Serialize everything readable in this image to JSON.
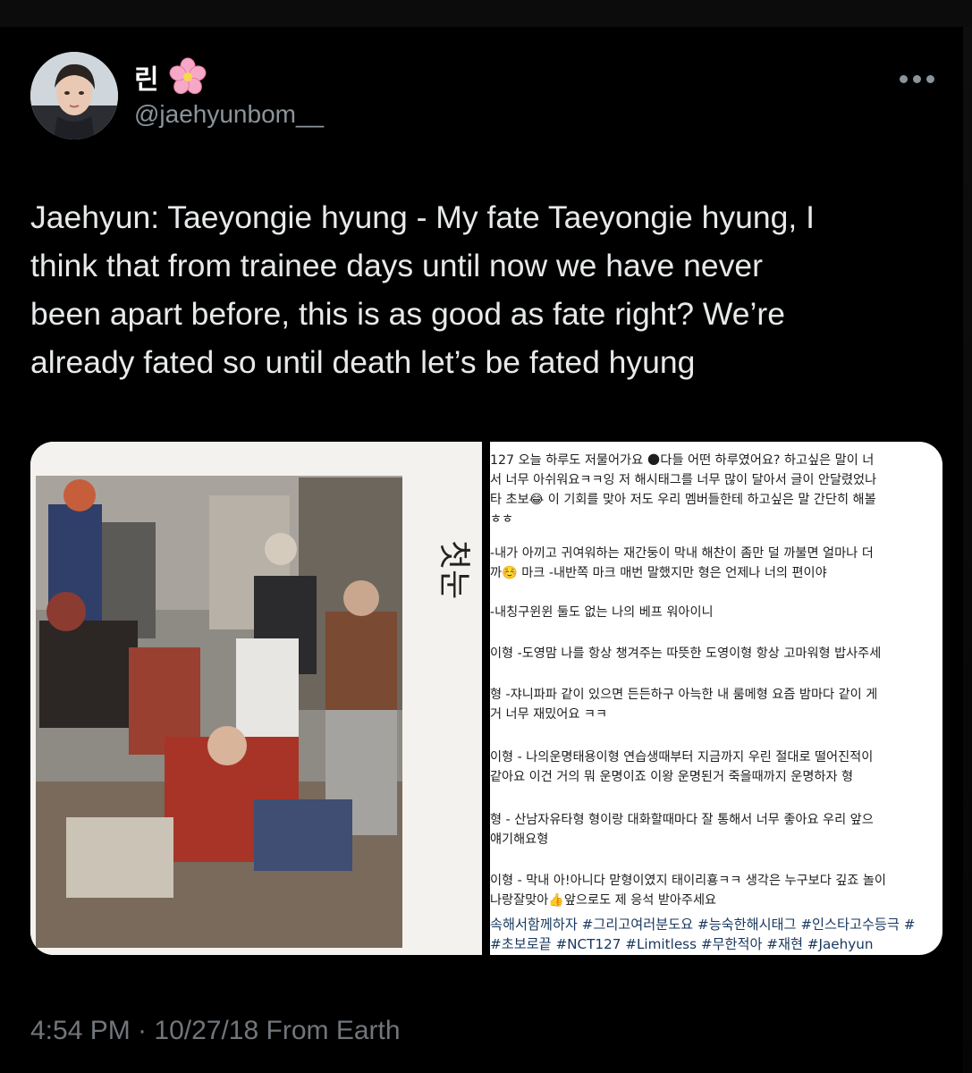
{
  "tweet": {
    "author_name": "린",
    "author_emoji": "cherry-blossom",
    "handle": "@jaehyunbom__",
    "text_lines": [
      "Jaehyun: Taeyongie hyung - My fate Taeyongie hyung, I",
      "think that from trainee days until now we have never",
      "been apart before, this is as good as fate right? We’re",
      "already fated so until death let’s be fated hyung"
    ],
    "timestamp": "4:54 PM · 10/27/18",
    "source": "From Earth"
  },
  "media": {
    "handwriting": "첫눈",
    "korean_lines": [
      "127 오늘 하루도 저물어가요 🌑다들 어떤 하루였어요? 하고싶은 말이 너",
      "서 너무 아쉬워요ㅋㅋ잉 저 해시태그를 너무 많이 달아서 글이 안달렸었나",
      "타 초보😂 이 기회를 맞아 저도 우리 멤버들한테 하고싶은 말 간단히 해볼",
      "ㅎㅎ",
      "-내가 아끼고 귀여워하는 재간둥이 막내 해찬이 좀만 덜 까불면 얼마나 더",
      "까☺️ 마크 -내반쪽 마크 매번 말했지만 형은 언제나 너의 편이야",
      "-내칭구윈윈 둘도 없는 나의 베프 워아이니",
      "이형 -도영맘 나를 항상 챙겨주는 따뜻한 도영이형 항상 고마워형 밥사주세",
      "형 -쟈니파파 같이 있으면 든든하구 아늑한 내 룸메형 요즘 밤마다 같이 게",
      "거 너무 재밌어요 ㅋㅋ",
      "이형 - 나의운명태용이형 연습생때부터 지금까지 우린 절대로 떨어진적이",
      "같아요 이건 거의 뭐 운명이죠 이왕 운명된거 죽을때까지 운명하자 형",
      "형 - 산남자유타형 형이랑 대화할때마다 잘 통해서 너무 좋아요 우리 앞으",
      "얘기해요형",
      "이형 - 막내 아!아니다 맏형이였지 태이리횽ㅋㅋ 생각은 누구보다 깊죠 놀이",
      "나랑잘맞아👍앞으로도 제 응석 받아주세요",
      "속해서함께하자 #그리고여러분도요 #능숙한해시태그 #인스타고수등극 #",
      "#초보로끝 #NCT127 #Limitless #무한적아 #재현 #Jaehyun"
    ]
  },
  "colors": {
    "background": "#000000",
    "text": "#e7e9ea",
    "secondary": "#71767b",
    "hashtag": "#17375e"
  }
}
